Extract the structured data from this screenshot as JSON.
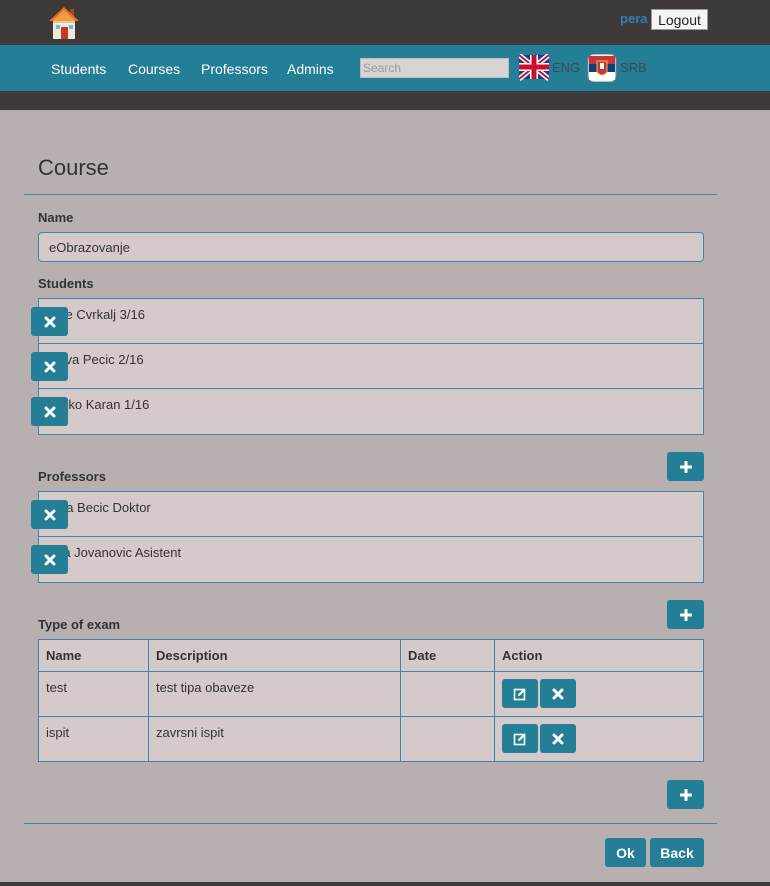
{
  "header": {
    "home_icon": "house-icon",
    "username": "pera",
    "logout_label": "Logout"
  },
  "nav": {
    "items": [
      "Students",
      "Courses",
      "Professors",
      "Admins"
    ],
    "search_placeholder": "Search",
    "languages": [
      {
        "code": "ENG",
        "icon": "uk-flag-icon"
      },
      {
        "code": "SRB",
        "icon": "serbia-flag-icon"
      }
    ]
  },
  "page": {
    "title": "Course",
    "name_label": "Name",
    "name_value": "eObrazovanje",
    "students_label": "Students",
    "students": [
      "Rale Cvrkalj 3/16",
      "Steva Pecic 2/16",
      "Marko Karan 1/16"
    ],
    "professors_label": "Professors",
    "professors": [
      "Mika Becic Doktor",
      "Zika Jovanovic Asistent"
    ],
    "exam_label": "Type of exam",
    "exam_table": {
      "headers": [
        "Name",
        "Description",
        "Date",
        "Action"
      ],
      "rows": [
        {
          "name": "test",
          "description": "test tipa obaveze",
          "date": ""
        },
        {
          "name": "ispit",
          "description": "zavrsni ispit",
          "date": ""
        }
      ]
    },
    "ok_label": "Ok",
    "back_label": "Back"
  },
  "colors": {
    "accent": "#247e96",
    "page_background": "#b8b0b0",
    "panel": "#d5c9c9",
    "topbar": "#3e3a3a",
    "username": "#2d7fb8"
  }
}
